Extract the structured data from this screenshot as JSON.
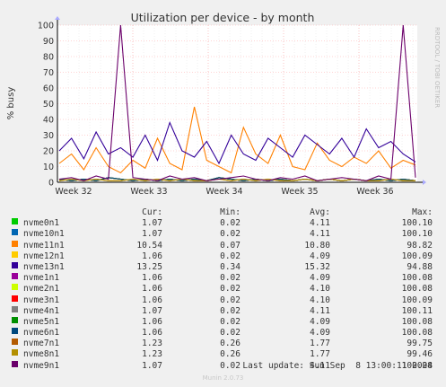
{
  "chart_data": {
    "type": "line",
    "title": "Utilization per device - by month",
    "ylabel": "% busy",
    "xlabel": "",
    "ylim": [
      0,
      100
    ],
    "yticks": [
      0,
      10,
      20,
      30,
      40,
      50,
      60,
      70,
      80,
      90,
      100
    ],
    "xticks": [
      "Week 32",
      "Week 33",
      "Week 34",
      "Week 35",
      "Week 36"
    ],
    "grid": true,
    "side_text": "RRDTOOL / TOBI OETIKER",
    "series": [
      {
        "name": "nvme0n1",
        "color": "#00cc00",
        "cur": "1.07",
        "min": "0.02",
        "avg": "4.11",
        "max": "100.10",
        "values": [
          2,
          1,
          2,
          1,
          3,
          2,
          1,
          2,
          1,
          2,
          1,
          2,
          1,
          3,
          2,
          1,
          2,
          1,
          2,
          1,
          2,
          1,
          2,
          1,
          2,
          1,
          2,
          1,
          2,
          1
        ]
      },
      {
        "name": "nvme10n1",
        "color": "#0066b3",
        "cur": "1.07",
        "min": "0.02",
        "avg": "4.11",
        "max": "100.10",
        "values": [
          2,
          1,
          2,
          1,
          3,
          2,
          1,
          2,
          1,
          2,
          1,
          2,
          1,
          3,
          2,
          1,
          2,
          1,
          2,
          1,
          2,
          1,
          2,
          1,
          2,
          1,
          2,
          1,
          2,
          1
        ]
      },
      {
        "name": "nvme11n1",
        "color": "#ff8000",
        "cur": "10.54",
        "min": "0.07",
        "avg": "10.80",
        "max": "98.82",
        "values": [
          12,
          18,
          8,
          22,
          10,
          6,
          14,
          9,
          28,
          12,
          8,
          48,
          14,
          10,
          6,
          35,
          18,
          12,
          30,
          10,
          8,
          25,
          14,
          10,
          16,
          12,
          20,
          9,
          14,
          11
        ]
      },
      {
        "name": "nvme12n1",
        "color": "#ffcc00",
        "cur": "1.06",
        "min": "0.02",
        "avg": "4.09",
        "max": "100.09",
        "values": [
          2,
          1,
          2,
          1,
          3,
          2,
          1,
          2,
          1,
          2,
          1,
          2,
          1,
          3,
          2,
          1,
          2,
          1,
          2,
          1,
          2,
          1,
          2,
          1,
          2,
          1,
          2,
          1,
          2,
          1
        ]
      },
      {
        "name": "nvme13n1",
        "color": "#330099",
        "cur": "13.25",
        "min": "0.34",
        "avg": "15.32",
        "max": "94.88",
        "values": [
          20,
          28,
          15,
          32,
          18,
          22,
          16,
          30,
          14,
          38,
          20,
          16,
          26,
          12,
          30,
          18,
          14,
          28,
          22,
          16,
          30,
          24,
          18,
          28,
          16,
          34,
          22,
          26,
          18,
          13
        ]
      },
      {
        "name": "nvme1n1",
        "color": "#990099",
        "cur": "1.06",
        "min": "0.02",
        "avg": "4.09",
        "max": "100.08",
        "values": [
          2,
          1,
          2,
          1,
          3,
          2,
          1,
          2,
          1,
          2,
          1,
          2,
          1,
          3,
          2,
          1,
          2,
          1,
          2,
          1,
          2,
          1,
          2,
          1,
          2,
          1,
          2,
          1,
          2,
          1
        ]
      },
      {
        "name": "nvme2n1",
        "color": "#ccff00",
        "cur": "1.06",
        "min": "0.02",
        "avg": "4.10",
        "max": "100.08",
        "values": [
          2,
          1,
          2,
          1,
          3,
          2,
          1,
          2,
          1,
          2,
          1,
          2,
          1,
          3,
          2,
          1,
          2,
          1,
          2,
          1,
          2,
          1,
          2,
          1,
          2,
          1,
          2,
          1,
          2,
          1
        ]
      },
      {
        "name": "nvme3n1",
        "color": "#ff0000",
        "cur": "1.06",
        "min": "0.02",
        "avg": "4.10",
        "max": "100.09",
        "values": [
          2,
          1,
          2,
          1,
          3,
          2,
          1,
          2,
          1,
          2,
          1,
          2,
          1,
          3,
          2,
          1,
          2,
          1,
          2,
          1,
          2,
          1,
          2,
          1,
          2,
          1,
          2,
          1,
          2,
          1
        ]
      },
      {
        "name": "nvme4n1",
        "color": "#808080",
        "cur": "1.07",
        "min": "0.02",
        "avg": "4.11",
        "max": "100.11",
        "values": [
          2,
          1,
          2,
          1,
          3,
          2,
          1,
          2,
          1,
          2,
          1,
          2,
          1,
          3,
          2,
          1,
          2,
          1,
          2,
          1,
          2,
          1,
          2,
          1,
          2,
          1,
          2,
          1,
          2,
          1
        ]
      },
      {
        "name": "nvme5n1",
        "color": "#008f00",
        "cur": "1.06",
        "min": "0.02",
        "avg": "4.09",
        "max": "100.08",
        "values": [
          2,
          1,
          2,
          1,
          3,
          2,
          1,
          2,
          1,
          2,
          1,
          2,
          1,
          3,
          2,
          1,
          2,
          1,
          2,
          1,
          2,
          1,
          2,
          1,
          2,
          1,
          2,
          1,
          2,
          1
        ]
      },
      {
        "name": "nvme6n1",
        "color": "#00487d",
        "cur": "1.06",
        "min": "0.02",
        "avg": "4.09",
        "max": "100.08",
        "values": [
          2,
          1,
          2,
          1,
          3,
          2,
          1,
          2,
          1,
          2,
          1,
          2,
          1,
          3,
          2,
          1,
          2,
          1,
          2,
          1,
          2,
          1,
          2,
          1,
          2,
          1,
          2,
          1,
          2,
          1
        ]
      },
      {
        "name": "nvme7n1",
        "color": "#b35a00",
        "cur": "1.23",
        "min": "0.26",
        "avg": "1.77",
        "max": "99.75",
        "values": [
          1,
          2,
          1,
          2,
          1,
          1,
          2,
          1,
          2,
          1,
          2,
          1,
          1,
          2,
          1,
          2,
          1,
          2,
          1,
          1,
          2,
          1,
          2,
          1,
          2,
          1,
          1,
          2,
          1,
          1
        ]
      },
      {
        "name": "nvme8n1",
        "color": "#b38f00",
        "cur": "1.23",
        "min": "0.26",
        "avg": "1.77",
        "max": "99.46",
        "values": [
          1,
          2,
          1,
          2,
          1,
          1,
          2,
          1,
          2,
          1,
          2,
          1,
          1,
          2,
          1,
          2,
          1,
          2,
          1,
          1,
          2,
          1,
          2,
          1,
          2,
          1,
          1,
          2,
          1,
          1
        ]
      },
      {
        "name": "nvme9n1",
        "color": "#6b006b",
        "cur": "1.07",
        "min": "0.02",
        "avg": "4.11",
        "max": "100.08",
        "values": [
          2,
          3,
          1,
          4,
          2,
          100,
          3,
          2,
          1,
          4,
          2,
          3,
          1,
          2,
          3,
          4,
          2,
          1,
          3,
          2,
          4,
          1,
          2,
          3,
          2,
          1,
          4,
          2,
          100,
          3
        ]
      }
    ]
  },
  "legend": {
    "head_cur": "Cur:",
    "head_min": "Min:",
    "head_avg": "Avg:",
    "head_max": "Max:"
  },
  "last_update": "Last update: Sun Sep  8 13:00:11 2024",
  "footer": "Munin 2.0.73"
}
